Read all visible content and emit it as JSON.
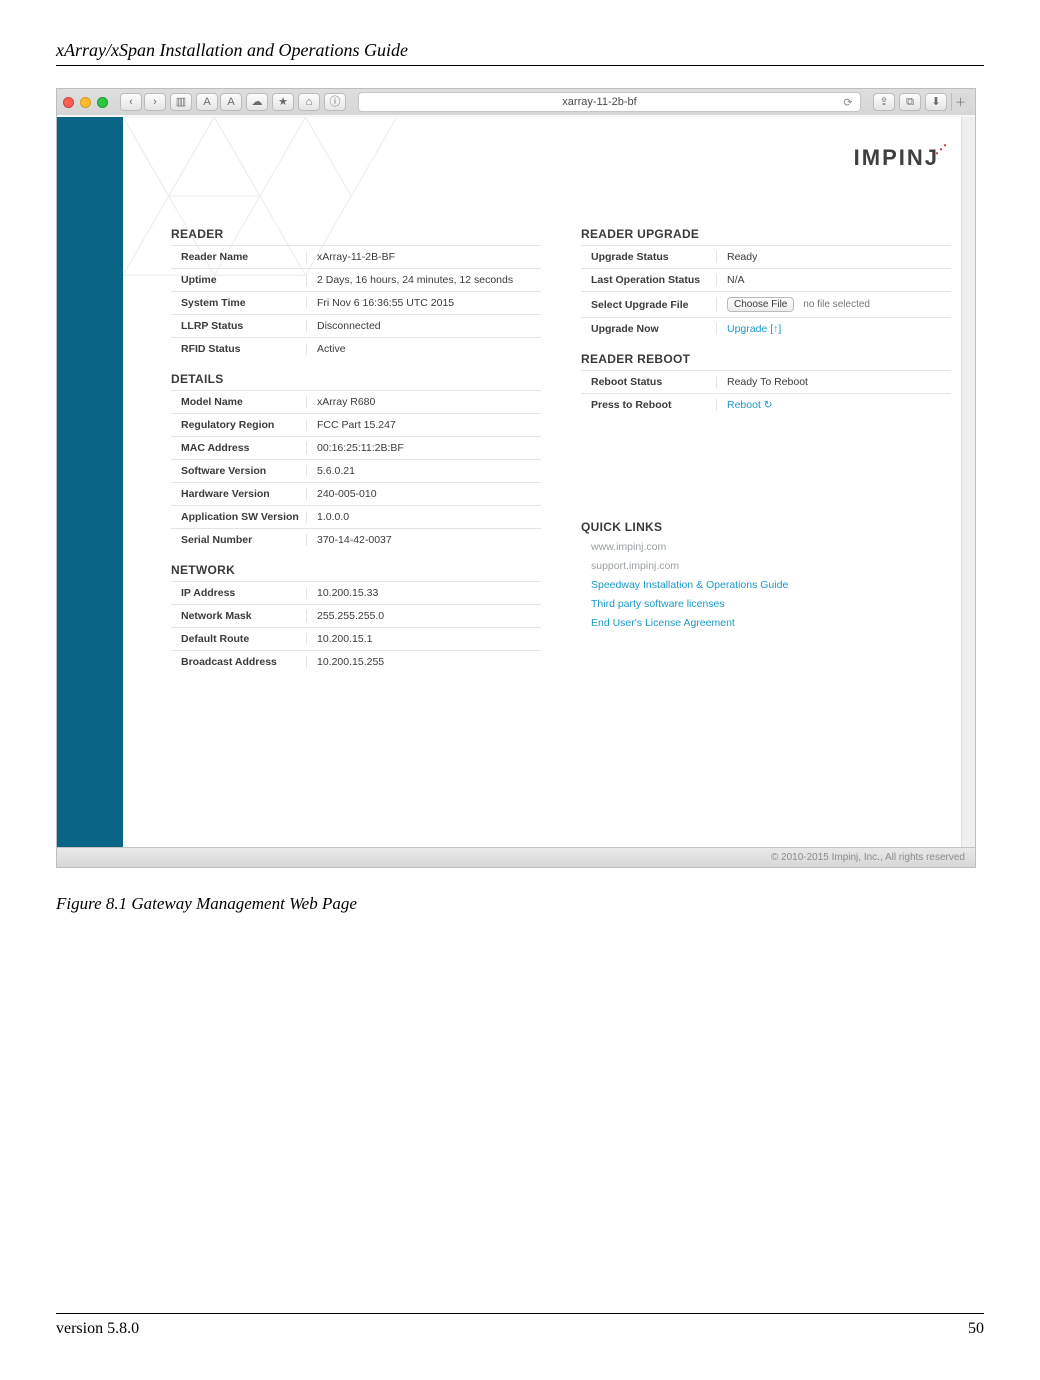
{
  "doc": {
    "header": "xArray/xSpan Installation and Operations Guide",
    "caption": "Figure 8.1 Gateway Management Web Page",
    "version": "version 5.8.0",
    "page": "50"
  },
  "browser": {
    "address": "xarray-11-2b-bf"
  },
  "logo": {
    "text": "IMPINJ"
  },
  "reader": {
    "title": "READER",
    "rows": {
      "reader_name": {
        "k": "Reader Name",
        "v": "xArray-11-2B-BF"
      },
      "uptime": {
        "k": "Uptime",
        "v": "2 Days, 16 hours, 24 minutes, 12 seconds"
      },
      "system_time": {
        "k": "System Time",
        "v": "Fri Nov 6 16:36:55 UTC 2015"
      },
      "llrp_status": {
        "k": "LLRP Status",
        "v": "Disconnected"
      },
      "rfid_status": {
        "k": "RFID Status",
        "v": "Active"
      }
    }
  },
  "details": {
    "title": "DETAILS",
    "rows": {
      "model": {
        "k": "Model Name",
        "v": "xArray R680"
      },
      "region": {
        "k": "Regulatory Region",
        "v": "FCC Part 15.247"
      },
      "mac": {
        "k": "MAC Address",
        "v": "00:16:25:11:2B:BF"
      },
      "swver": {
        "k": "Software Version",
        "v": "5.6.0.21"
      },
      "hwver": {
        "k": "Hardware Version",
        "v": "240-005-010"
      },
      "appver": {
        "k": "Application SW Version",
        "v": "1.0.0.0"
      },
      "serial": {
        "k": "Serial Number",
        "v": "370-14-42-0037"
      }
    }
  },
  "network": {
    "title": "NETWORK",
    "rows": {
      "ip": {
        "k": "IP Address",
        "v": "10.200.15.33"
      },
      "mask": {
        "k": "Network Mask",
        "v": "255.255.255.0"
      },
      "route": {
        "k": "Default Route",
        "v": "10.200.15.1"
      },
      "bcast": {
        "k": "Broadcast Address",
        "v": "10.200.15.255"
      }
    }
  },
  "upgrade": {
    "title": "READER UPGRADE",
    "rows": {
      "status": {
        "k": "Upgrade Status",
        "v": "Ready"
      },
      "last": {
        "k": "Last Operation Status",
        "v": "N/A"
      },
      "file": {
        "k": "Select Upgrade File",
        "btn": "Choose File",
        "nofile": "no file selected"
      },
      "now": {
        "k": "Upgrade Now",
        "v": "Upgrade "
      }
    }
  },
  "reboot": {
    "title": "READER REBOOT",
    "rows": {
      "status": {
        "k": "Reboot Status",
        "v": "Ready To Reboot"
      },
      "press": {
        "k": "Press to Reboot",
        "v": "Reboot "
      }
    }
  },
  "quicklinks": {
    "title": "QUICK LINKS",
    "items": {
      "impinj": "www.impinj.com",
      "support": "support.impinj.com",
      "guide": "Speedway Installation & Operations Guide",
      "licenses": "Third party software licenses",
      "eula": "End User's License Agreement"
    }
  },
  "footer_copy": "© 2010-2015 Impinj, Inc., All rights reserved"
}
